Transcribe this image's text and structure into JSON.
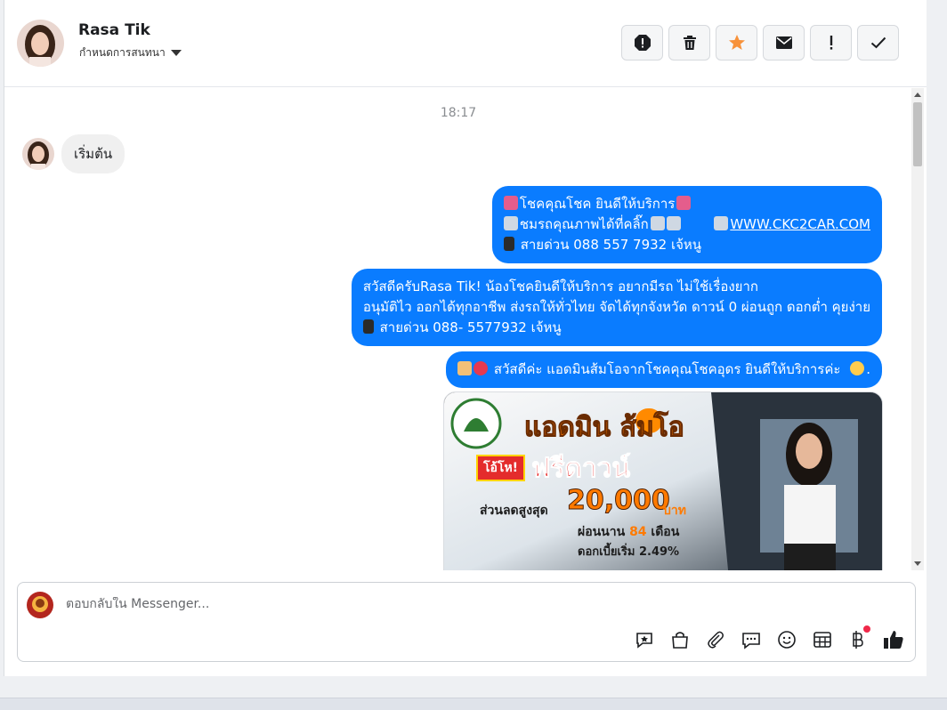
{
  "header": {
    "contact_name": "Rasa Tik",
    "assign_label": "กำหนดการสนทนา"
  },
  "actions": [
    {
      "name": "report-icon"
    },
    {
      "name": "trash-icon"
    },
    {
      "name": "star-icon",
      "color": "#f7923b"
    },
    {
      "name": "envelope-icon"
    },
    {
      "name": "exclamation-icon"
    },
    {
      "name": "check-icon"
    }
  ],
  "chat": {
    "timestamp": "18:17",
    "incoming": {
      "text": "เริ่มต้น"
    },
    "outgoing": [
      {
        "line1": "โชคคุณโชค ยินดีให้บริการ",
        "line2a": "ชมรถคุณภาพได้ที่คลิ๊ก",
        "line2_link": "WWW.CKC2CAR.COM",
        "line3": "สายด่วน 088 557 7932 เจ้หนู"
      },
      {
        "line1": "สวัสดีครับRasa Tik! น้องโชคยินดีให้บริการ อยากมีรถ ไม่ใช้เรื่องยาก",
        "line2": "อนุมัติไว ออกได้ทุกอาชีพ ส่งรถให้ทั่วไทย จัดได้ทุกจังหวัด ดาวน์ 0  ผ่อนถูก ดอกต่ำ คุยง่าย",
        "line3": "สายด่วน 088- 5577932 เจ้หนู"
      },
      {
        "line1": "สวัสดีค่ะ แอดมินส้มโอจากโชคคุณโชคอุดร ยินดีให้บริการค่ะ",
        "line1_end": "."
      }
    ],
    "promo": {
      "heading": "แอดมิน ส้มโอ",
      "badge": "โอ้โห!",
      "free_down": "ฟรีดาวน์",
      "discount_label": "ส่วนลดสูงสุด",
      "discount_amount": "20,000",
      "currency": "บาท",
      "installment_prefix": "ผ่อนนาน",
      "installment_months": "84",
      "installment_suffix": "เดือน",
      "interest": "ดอกเบี้ยเริ่ม 2.49%"
    }
  },
  "composer": {
    "placeholder": "ตอบกลับใน Messenger...",
    "tools": [
      "sticker-plus-icon",
      "shop-bag-icon",
      "paperclip-icon",
      "chat-bubble-icon",
      "smiley-icon",
      "table-icon",
      "baht-icon",
      "thumbs-up-icon"
    ],
    "accent": "#0a7cff"
  }
}
